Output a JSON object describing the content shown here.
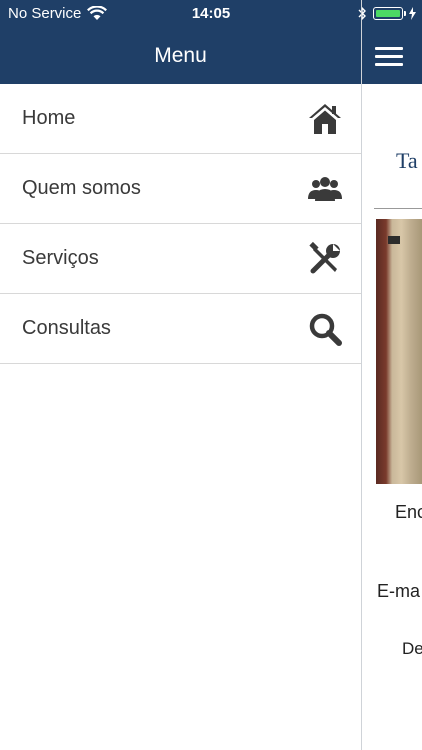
{
  "status_bar": {
    "carrier": "No Service",
    "time": "14:05"
  },
  "menu": {
    "title": "Menu",
    "items": [
      {
        "label": "Home",
        "icon": "home-icon"
      },
      {
        "label": "Quem somos",
        "icon": "users-icon"
      },
      {
        "label": "Serviços",
        "icon": "tools-icon"
      },
      {
        "label": "Consultas",
        "icon": "search-icon"
      }
    ]
  },
  "content": {
    "title_fragment": "Ta",
    "line1": "Enc",
    "line2": "E-ma",
    "line3": "De"
  },
  "colors": {
    "header": "#1f3f67",
    "battery": "#4cd964"
  }
}
